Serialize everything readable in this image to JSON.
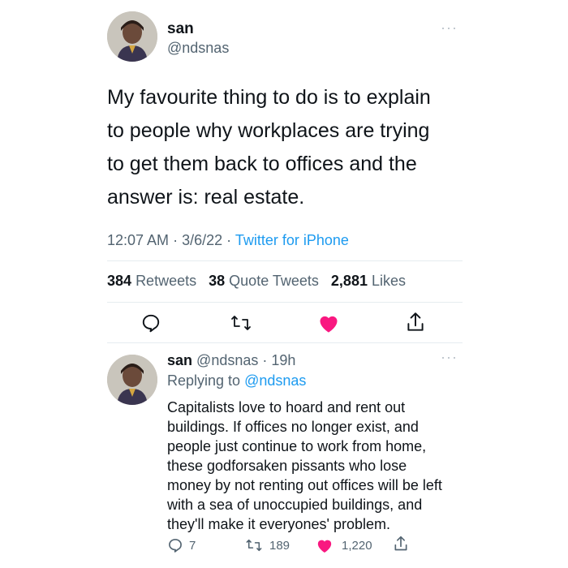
{
  "main_tweet": {
    "display_name": "san",
    "handle": "@ndsnas",
    "more": "···",
    "text_lines": [
      "My favourite thing to do is to explain",
      "to people why workplaces are trying",
      "to get them back to offices and the",
      "answer is: real estate."
    ],
    "time": "12:07 AM",
    "date": "3/6/22",
    "source": "Twitter for iPhone",
    "sep": "·",
    "stats": {
      "retweets_count": "384",
      "retweets_label": "Retweets",
      "quotes_count": "38",
      "quotes_label": "Quote Tweets",
      "likes_count": "2,881",
      "likes_label": "Likes"
    }
  },
  "reply_tweet": {
    "display_name": "san",
    "handle": "@ndsnas",
    "sep": "·",
    "age": "19h",
    "more": "···",
    "replying_label": "Replying to",
    "replying_handle": "@ndsnas",
    "text_lines": [
      "Capitalists love to hoard and rent out",
      "buildings. If offices no longer exist, and",
      "people just continue to work from home,",
      "these godforsaken pissants who lose",
      "money by not renting out offices will be left",
      "with a sea of unoccupied buildings, and",
      "they'll make it everyones' problem."
    ],
    "actions": {
      "reply_count": "7",
      "retweet_count": "189",
      "like_count": "1,220"
    }
  },
  "colors": {
    "like": "#f91880",
    "link": "#1d9bf0",
    "icon": "#536471"
  },
  "icons": [
    "reply-icon",
    "retweet-icon",
    "like-icon",
    "share-icon",
    "more-icon"
  ]
}
